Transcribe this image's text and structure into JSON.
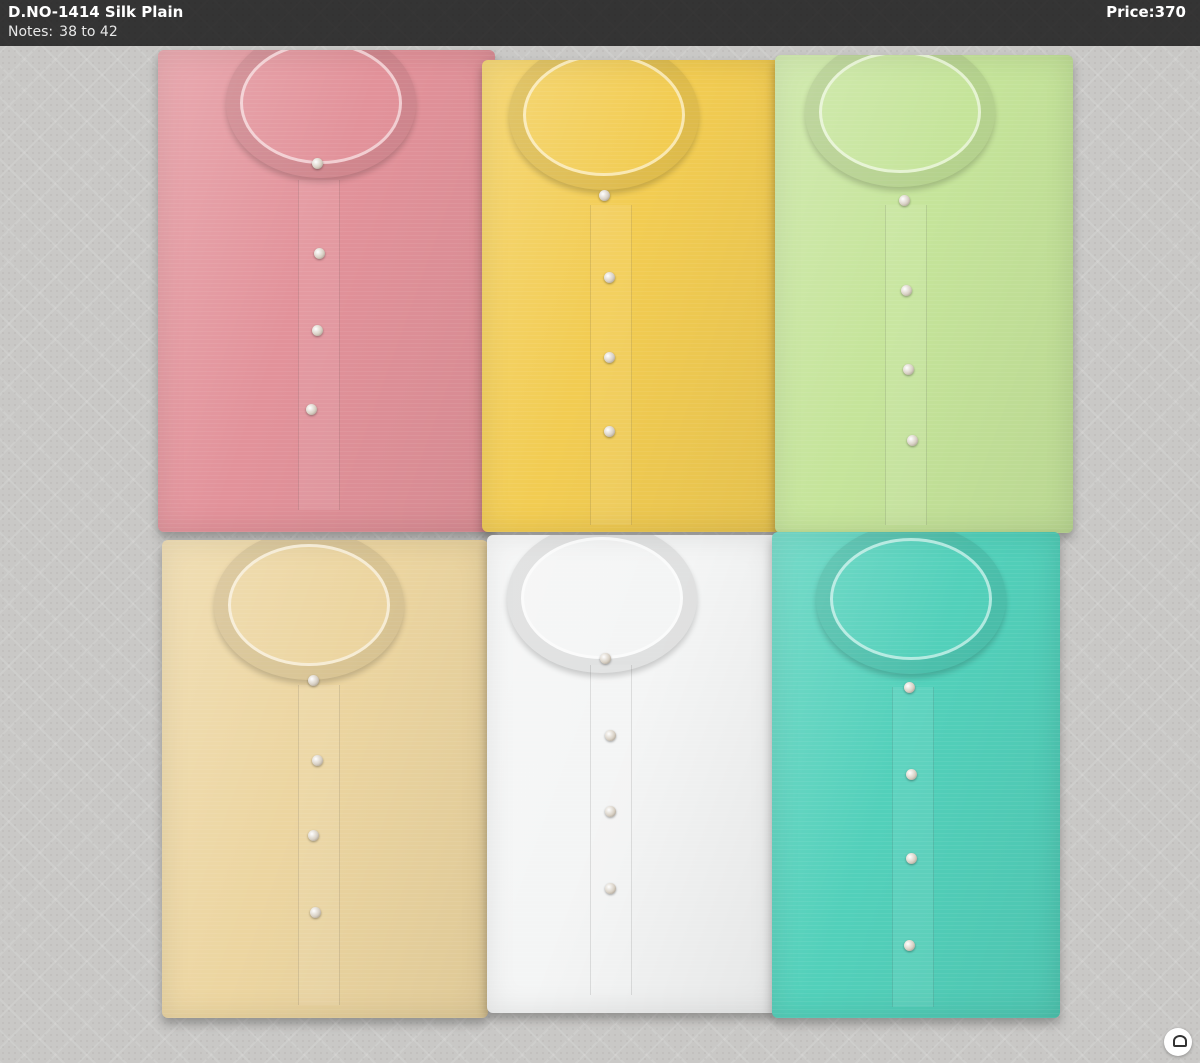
{
  "header": {
    "title": "D.NO-1414 Silk Plain",
    "notes_label": "Notes:",
    "notes_value": "38 to 42",
    "price": "Price:370"
  },
  "products": [
    {
      "color_name": "pink",
      "color": "#e2929a"
    },
    {
      "color_name": "yellow",
      "color": "#f2cc52"
    },
    {
      "color_name": "pista-green",
      "color": "#c5e49a"
    },
    {
      "color_name": "beige",
      "color": "#ecd5a0"
    },
    {
      "color_name": "white",
      "color": "#f4f5f5"
    },
    {
      "color_name": "sea-green",
      "color": "#52d0ba"
    }
  ]
}
